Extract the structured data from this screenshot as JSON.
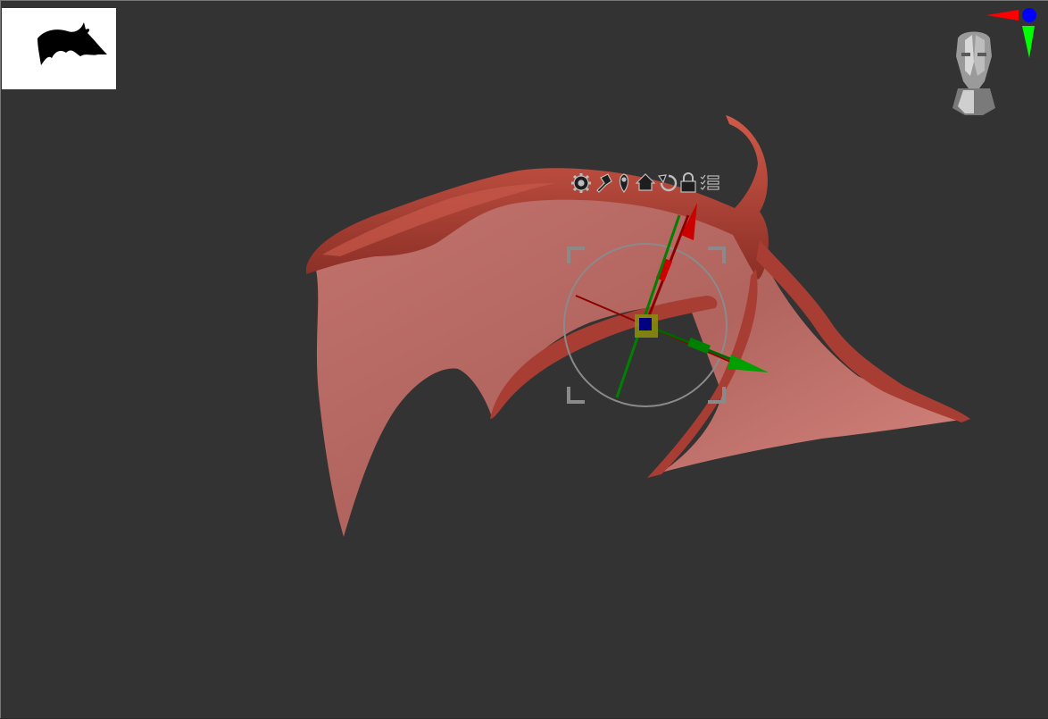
{
  "viewport": {
    "background": "#333333",
    "border": "#777777"
  },
  "thumbnail": {
    "icon": "wing-silhouette-icon",
    "background": "#ffffff"
  },
  "model": {
    "bone_color": "#b0463a",
    "membrane_color": "#d4807a"
  },
  "gizmo_toolbar": {
    "icons": [
      "gear-icon",
      "pin-icon",
      "location-pin-icon",
      "home-icon",
      "reset-rotate-icon",
      "lock-icon",
      "checklist-icon"
    ]
  },
  "gizmo": {
    "axis_colors": {
      "x": "#c00000",
      "y": "#008000",
      "z": "#000080"
    },
    "ring_color": "#8a8a8a"
  },
  "navigation": {
    "head_icon": "orientation-head-icon",
    "axis_colors": {
      "x": "#ff0000",
      "y": "#00ff00",
      "z": "#0000ff"
    }
  }
}
